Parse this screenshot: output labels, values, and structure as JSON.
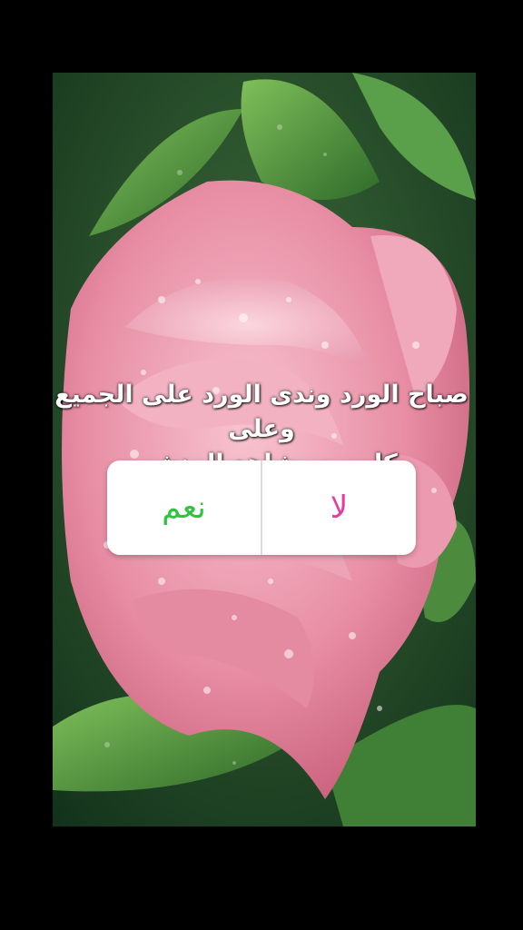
{
  "story": {
    "caption_line1": "صباح الورد وندى الورد على الجميع وعلى",
    "caption_line2": "كل من يشاهد المنشور"
  },
  "poll": {
    "option_yes": "نعم",
    "option_no": "لا",
    "colors": {
      "yes": "#2fc33f",
      "no": "#e13fa0"
    }
  },
  "background_image": {
    "icon": "pink-rose-photo"
  }
}
